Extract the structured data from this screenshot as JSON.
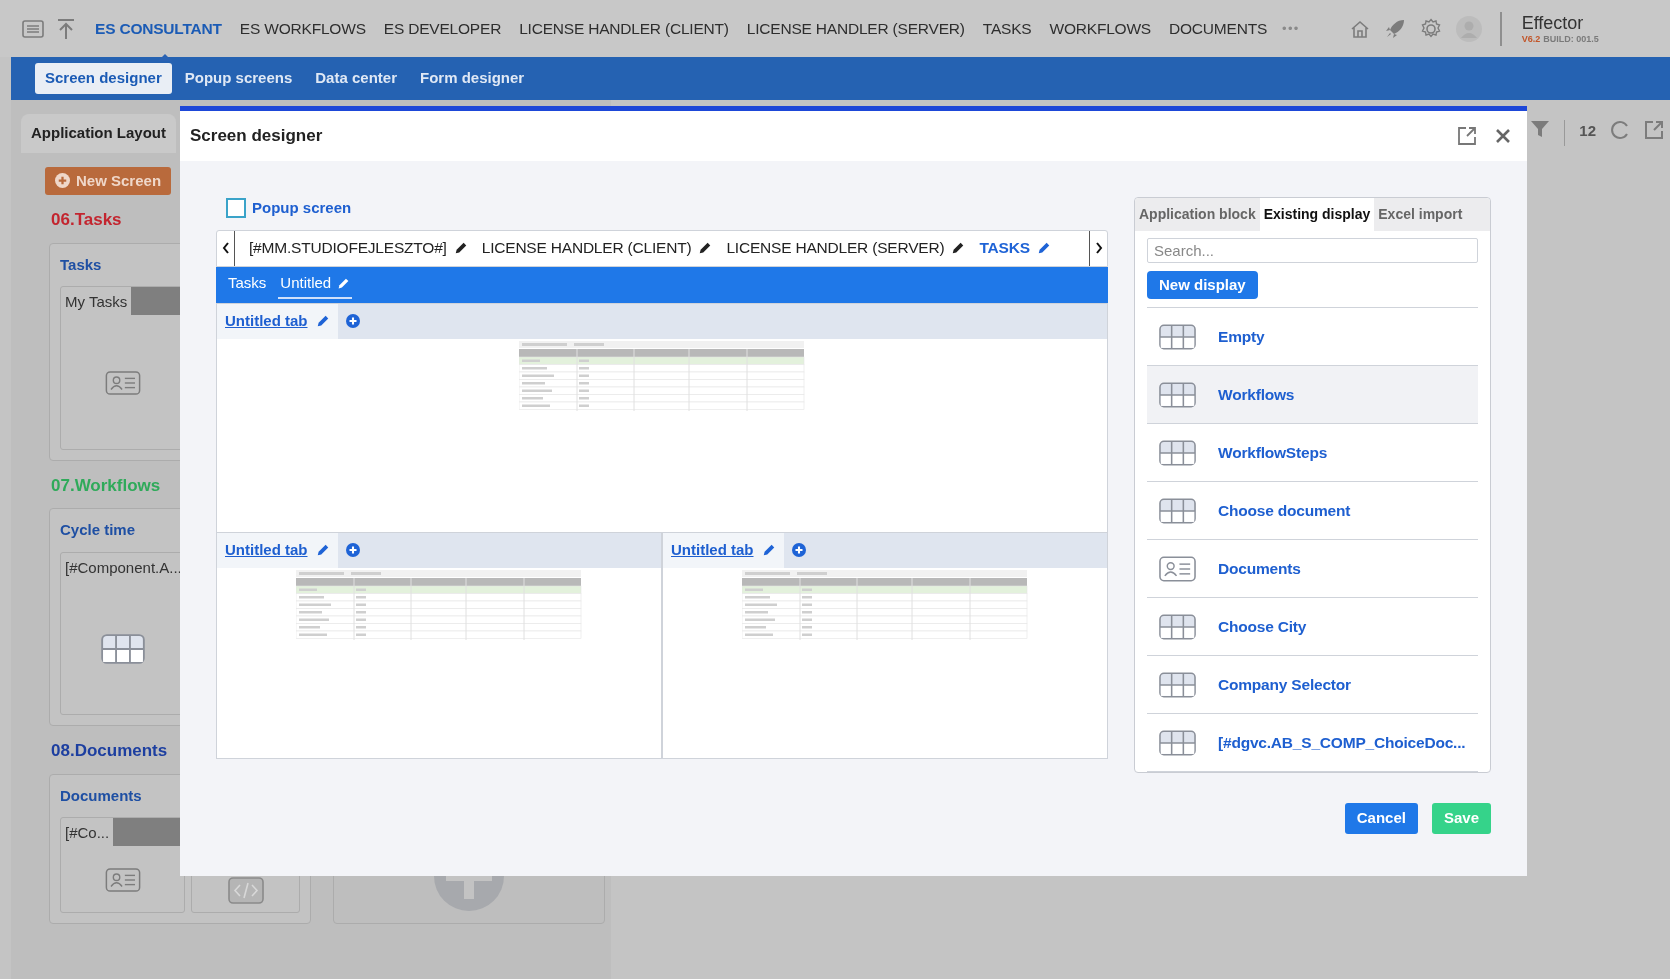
{
  "top_nav": {
    "items": [
      {
        "label": "ES CONSULTANT",
        "selected": true
      },
      {
        "label": "ES WORKFLOWS",
        "selected": false
      },
      {
        "label": "ES DEVELOPER",
        "selected": false
      },
      {
        "label": "LICENSE HANDLER (CLIENT)",
        "selected": false
      },
      {
        "label": "LICENSE HANDLER (SERVER)",
        "selected": false
      },
      {
        "label": "TASKS",
        "selected": false
      },
      {
        "label": "WORKFLOWS",
        "selected": false
      },
      {
        "label": "DOCUMENTS",
        "selected": false
      }
    ],
    "more": "•••",
    "app_name": "Effector",
    "version": "V6.2",
    "build": "BUILD: 001.5"
  },
  "sub_nav": [
    {
      "label": "Screen designer",
      "selected": true
    },
    {
      "label": "Popup screens",
      "selected": false
    },
    {
      "label": "Data center",
      "selected": false
    },
    {
      "label": "Form designer",
      "selected": false
    }
  ],
  "layout_panel": {
    "title": "Application Layout",
    "new_screen_button": "New Screen",
    "groups": [
      {
        "title": "06.Tasks",
        "color": "#c3252f",
        "card": {
          "title": "Tasks",
          "item": "My Tasks"
        }
      },
      {
        "title": "07.Workflows",
        "color": "#2faa5a",
        "card": {
          "title": "Cycle time",
          "item": "[#Component.A..."
        }
      },
      {
        "title": "08.Documents",
        "color": "#1d3fa0",
        "card": {
          "title": "Documents",
          "item": "[#Co..."
        }
      }
    ]
  },
  "toolbar": {
    "count": "12"
  },
  "modal": {
    "title": "Screen designer",
    "popup_screen": {
      "label": "Popup screen",
      "checked": false
    },
    "screen_tabs": [
      {
        "label": "[#MM.STUDIOFEJLESZTO#]",
        "selected": false
      },
      {
        "label": "LICENSE HANDLER (CLIENT)",
        "selected": false
      },
      {
        "label": "LICENSE HANDLER (SERVER)",
        "selected": false
      },
      {
        "label": "TASKS",
        "selected": true
      }
    ],
    "sub_tabs": [
      {
        "label": "Tasks",
        "selected": false
      },
      {
        "label": "Untitled",
        "selected": true
      }
    ],
    "panes": [
      {
        "tab_label": "Untitled tab"
      },
      {
        "tab_label": "Untitled tab"
      },
      {
        "tab_label": "Untitled tab"
      }
    ],
    "side_panel": {
      "tabs": [
        {
          "label": "Application block",
          "selected": false
        },
        {
          "label": "Existing display",
          "selected": true
        },
        {
          "label": "Excel import",
          "selected": false
        }
      ],
      "search_placeholder": "Search...",
      "new_display_button": "New display",
      "items": [
        {
          "label": "Empty",
          "kind": "grid",
          "selected": false
        },
        {
          "label": "Workflows",
          "kind": "grid",
          "selected": true
        },
        {
          "label": "WorkflowSteps",
          "kind": "grid",
          "selected": false
        },
        {
          "label": "Choose document",
          "kind": "grid",
          "selected": false
        },
        {
          "label": "Documents",
          "kind": "form",
          "selected": false
        },
        {
          "label": "Choose City",
          "kind": "grid",
          "selected": false
        },
        {
          "label": "Company Selector",
          "kind": "grid",
          "selected": false
        },
        {
          "label": "[#dgvc.AB_S_COMP_ChoiceDoc...",
          "kind": "grid",
          "selected": false
        }
      ]
    },
    "cancel_button": "Cancel",
    "save_button": "Save"
  }
}
